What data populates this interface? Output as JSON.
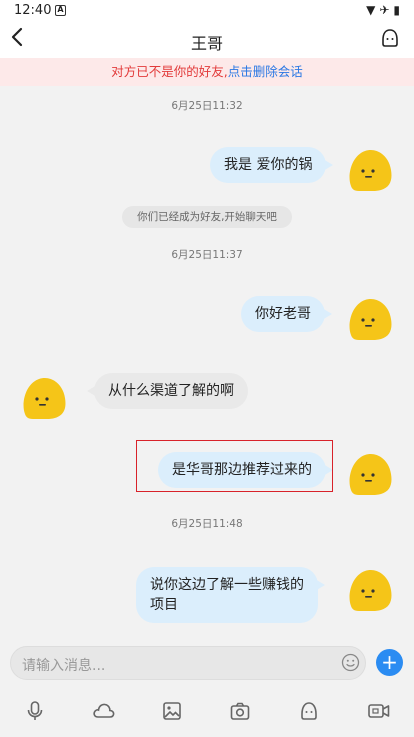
{
  "status_bar": {
    "time": "12:40",
    "notif_icon": "A"
  },
  "header": {
    "title": "王哥"
  },
  "notice": {
    "text": "对方已不是你的好友,",
    "link": "点击删除会话"
  },
  "messages": [
    {
      "type": "time",
      "text": "6月25日11:32"
    },
    {
      "type": "out",
      "text": "我是 爱你的锅"
    },
    {
      "type": "system",
      "text": "你们已经成为好友,开始聊天吧"
    },
    {
      "type": "time",
      "text": "6月25日11:37"
    },
    {
      "type": "out",
      "text": "你好老哥"
    },
    {
      "type": "in",
      "text": "从什么渠道了解的啊"
    },
    {
      "type": "out",
      "text": "是华哥那边推荐过来的"
    },
    {
      "type": "time",
      "text": "6月25日11:48"
    },
    {
      "type": "out",
      "lines": [
        "说你这边了解一些赚钱的",
        "项目"
      ]
    }
  ],
  "input": {
    "placeholder": "请输入消息..."
  },
  "toolbar": [
    "microphone-icon",
    "cloud-icon",
    "image-icon",
    "camera-icon",
    "emoji-icon",
    "video-icon"
  ],
  "colors": {
    "accent": "#2b8cf2",
    "notice_red": "#e23a3a",
    "link_blue": "#2b78e4",
    "out_bubble": "#dbeefc",
    "avatar": "#f5c518"
  }
}
